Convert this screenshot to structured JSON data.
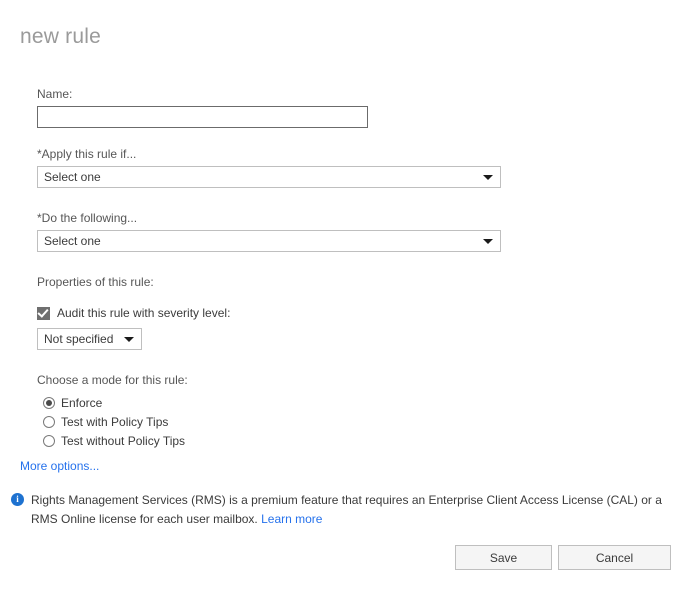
{
  "page": {
    "title": "new rule"
  },
  "form": {
    "name_label": "Name:",
    "name_value": "",
    "name_placeholder": "",
    "apply_label": "*Apply this rule if...",
    "apply_value": "Select one",
    "do_label": "*Do the following...",
    "do_value": "Select one",
    "properties_label": "Properties of this rule:",
    "audit_checkbox_label": "Audit this rule with severity level:",
    "audit_checked": true,
    "severity_value": "Not specified",
    "mode_label": "Choose a mode for this rule:",
    "modes": [
      {
        "label": "Enforce",
        "selected": true
      },
      {
        "label": "Test with Policy Tips",
        "selected": false
      },
      {
        "label": "Test without Policy Tips",
        "selected": false
      }
    ]
  },
  "links": {
    "more_options": "More options..."
  },
  "info": {
    "icon": "info-icon",
    "text": "Rights Management Services (RMS) is a premium feature that requires an Enterprise Client Access License (CAL) or a RMS Online license for each user mailbox.",
    "link_label": "Learn more"
  },
  "buttons": {
    "save": "Save",
    "cancel": "Cancel"
  },
  "colors": {
    "link": "#2672ec",
    "info_icon": "#1e72d0",
    "title": "#9a9a9a",
    "text": "#3b3b3b"
  }
}
